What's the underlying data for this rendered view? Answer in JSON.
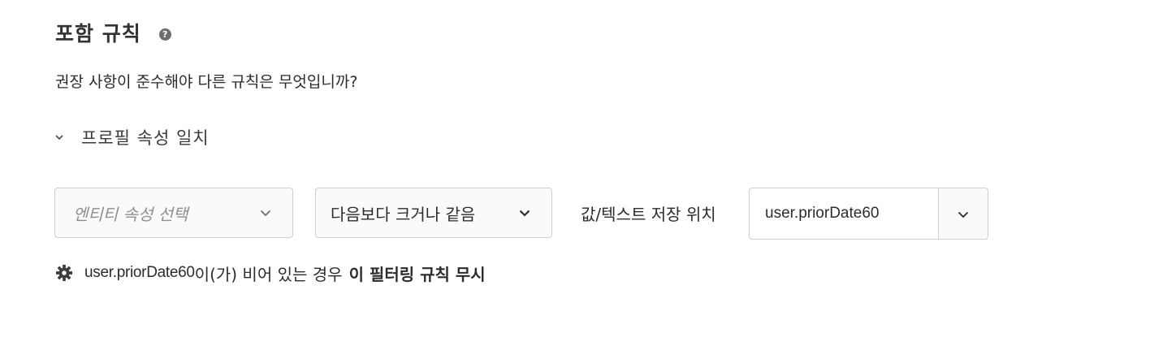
{
  "section": {
    "title": "포함 규칙",
    "help_icon": "question-mark-icon",
    "help_symbol": "?"
  },
  "question": "권장 사항이 준수해야 다른 규칙은 무엇입니까?",
  "profile_match": {
    "label": "프로필 속성 일치",
    "expanded": true,
    "toggle_icon": "chevron-down-icon"
  },
  "rule": {
    "attribute_placeholder": "엔티티 속성 선택",
    "operator_selected": "다음보다 크거나 같음",
    "value_label": "값/텍스트 저장 위치",
    "value_input": "user.priorDate60",
    "value_dropdown_icon": "chevron-down-icon"
  },
  "ignore": {
    "icon": "gear-icon",
    "variable": "user.priorDate60",
    "text": "이(가) 비어 있는 경우",
    "strong": "이 필터링 규칙 무시"
  },
  "colors": {
    "text": "#2c2c2c",
    "border": "#cfcfcf",
    "placeholder": "#8e8e8e",
    "help_icon_bg": "#6e6e6e"
  }
}
